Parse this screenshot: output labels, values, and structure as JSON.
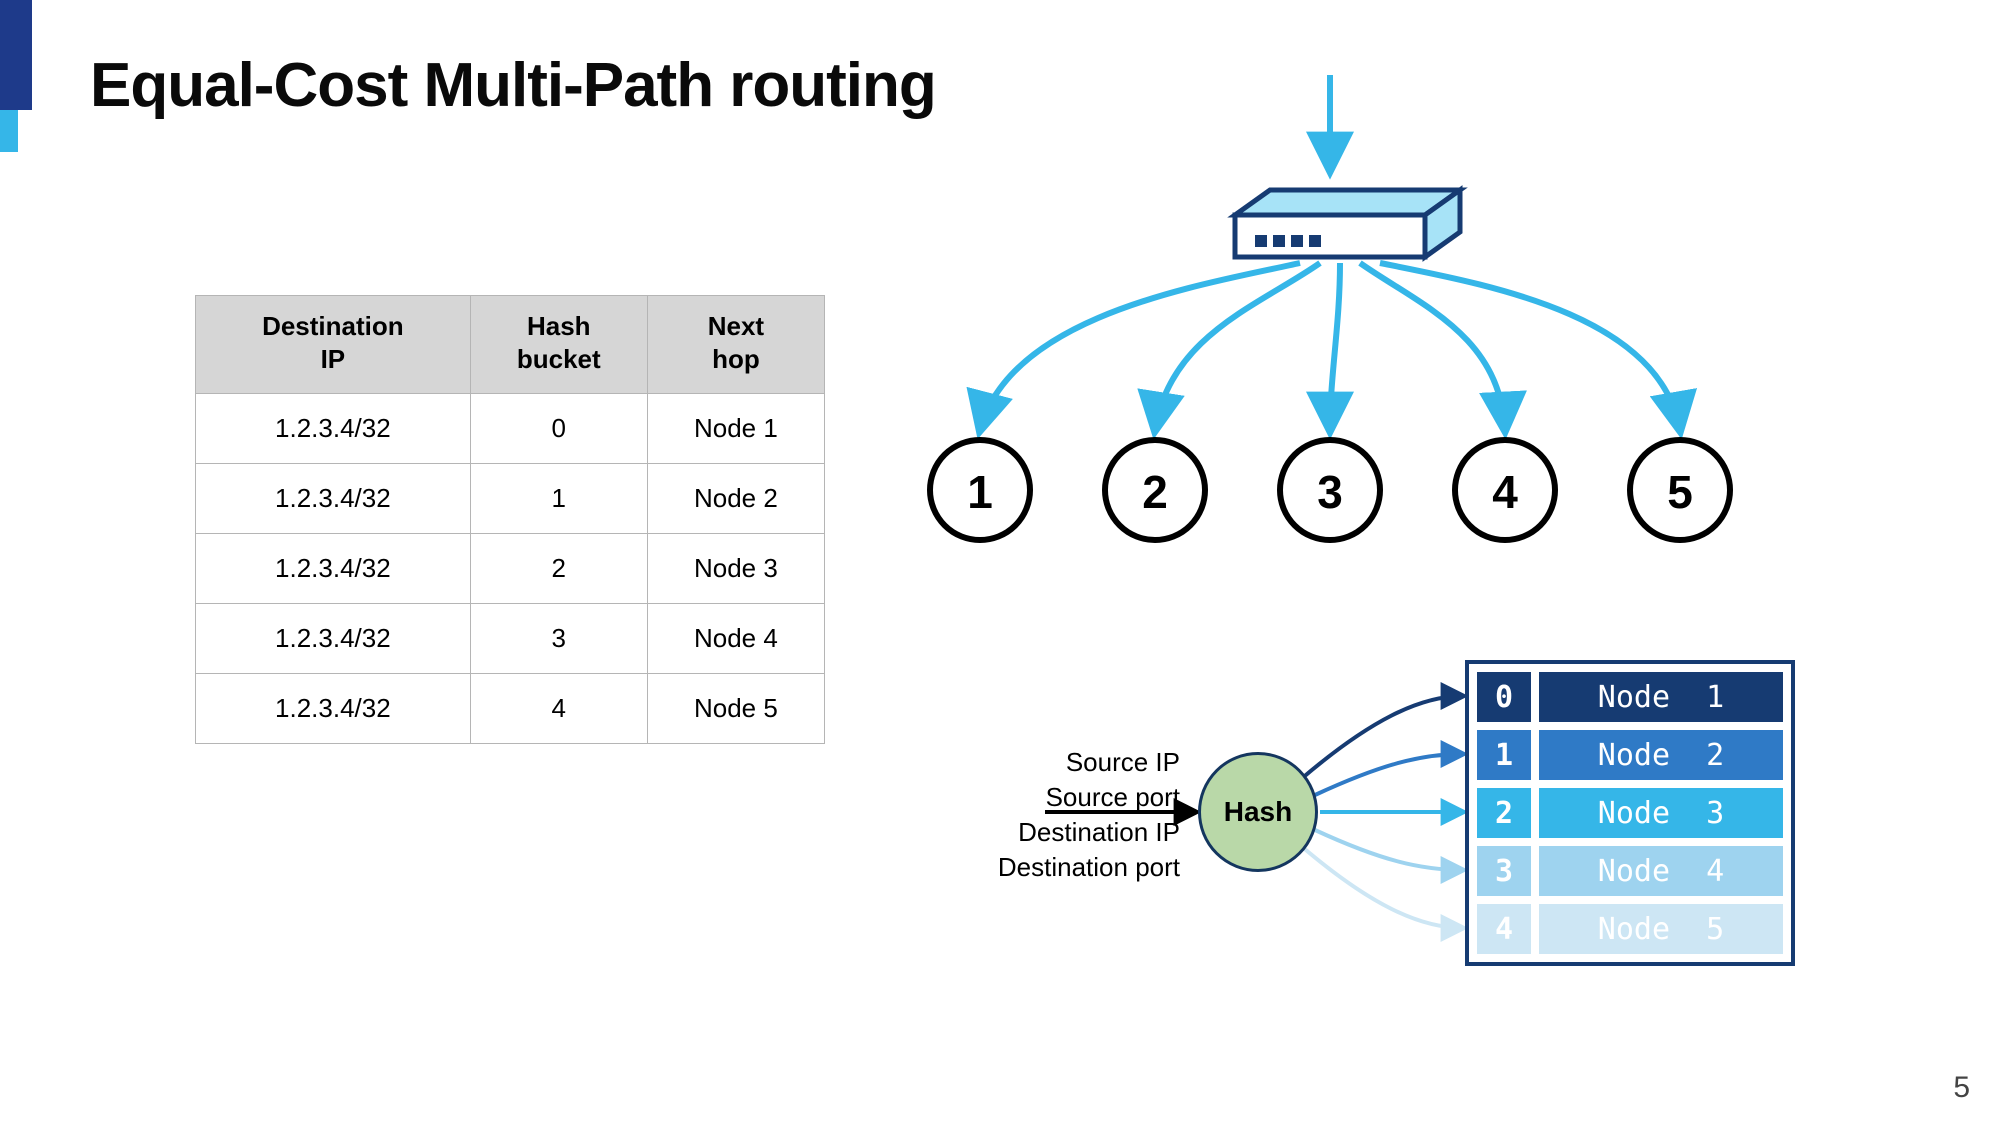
{
  "title": "Equal-Cost Multi-Path routing",
  "page_number": "5",
  "table": {
    "headers": [
      "Destination IP",
      "Hash bucket",
      "Next hop"
    ],
    "rows": [
      [
        "1.2.3.4/32",
        "0",
        "Node 1"
      ],
      [
        "1.2.3.4/32",
        "1",
        "Node 2"
      ],
      [
        "1.2.3.4/32",
        "2",
        "Node 3"
      ],
      [
        "1.2.3.4/32",
        "3",
        "Node 4"
      ],
      [
        "1.2.3.4/32",
        "4",
        "Node 5"
      ]
    ]
  },
  "router_diagram": {
    "nodes": [
      "1",
      "2",
      "3",
      "4",
      "5"
    ]
  },
  "hash_diagram": {
    "inputs": [
      "Source IP",
      "Source port",
      "Destination IP",
      "Destination port"
    ],
    "hash_label": "Hash",
    "buckets": [
      {
        "idx": "0",
        "label": "Node 1",
        "color": "#163b72"
      },
      {
        "idx": "1",
        "label": "Node 2",
        "color": "#2f7ac6"
      },
      {
        "idx": "2",
        "label": "Node 3",
        "color": "#35b6e8"
      },
      {
        "idx": "3",
        "label": "Node 4",
        "color": "#9ed3ef"
      },
      {
        "idx": "4",
        "label": "Node 5",
        "color": "#cde6f4"
      }
    ]
  }
}
